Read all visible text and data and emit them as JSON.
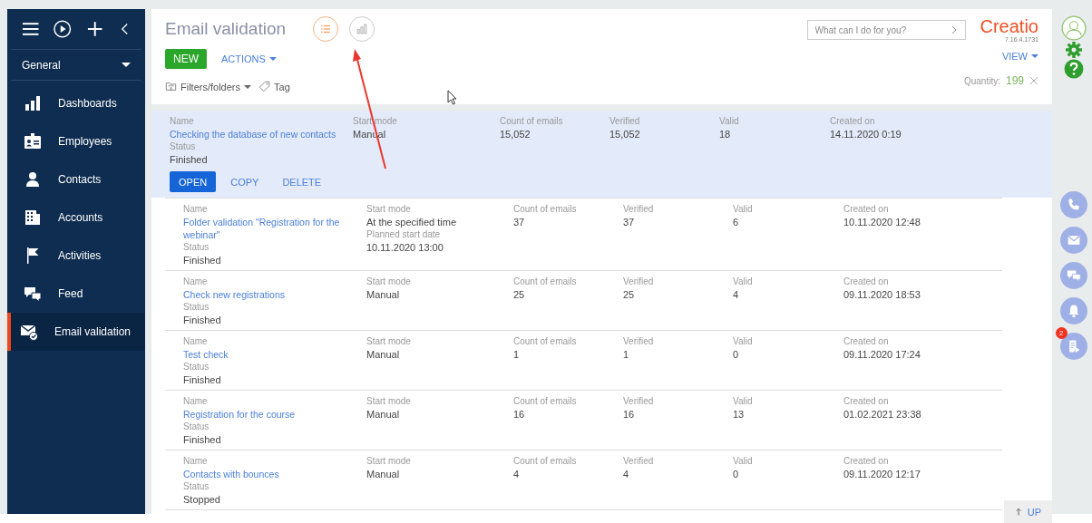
{
  "sidebar": {
    "section": "General",
    "items": [
      {
        "label": "Dashboards",
        "kind": "dashboards",
        "selected": false
      },
      {
        "label": "Employees",
        "kind": "employees",
        "selected": false
      },
      {
        "label": "Contacts",
        "kind": "contacts",
        "selected": false
      },
      {
        "label": "Accounts",
        "kind": "accounts",
        "selected": false
      },
      {
        "label": "Activities",
        "kind": "activities",
        "selected": false
      },
      {
        "label": "Feed",
        "kind": "feed",
        "selected": false
      },
      {
        "label": "Email validation",
        "kind": "email",
        "selected": true
      }
    ]
  },
  "header": {
    "title": "Email validation",
    "view_modes": [
      {
        "kind": "list",
        "selected": true
      },
      {
        "kind": "chart",
        "selected": false
      }
    ],
    "new_button": "NEW",
    "actions_menu": "ACTIONS",
    "search": {
      "placeholder": "What can I do for you?"
    },
    "logo": "Creatio",
    "version": "7.16.4.1731",
    "view_menu": "VIEW",
    "filters": "Filters/folders",
    "tag": "Tag",
    "quantity_label": "Quantity:",
    "quantity": "199"
  },
  "rows": [
    {
      "selected": true,
      "columns": [
        [
          {
            "label": "Name",
            "value": "Checking the database of new contacts",
            "kind": "link"
          },
          {
            "label": "Status",
            "value": "Finished",
            "kind": "text"
          }
        ],
        [
          {
            "label": "Start mode",
            "value": "Manual",
            "kind": "text"
          }
        ],
        [
          {
            "label": "Count of emails",
            "value": "15,052",
            "kind": "text"
          }
        ],
        [
          {
            "label": "Verified",
            "value": "15,052",
            "kind": "text"
          }
        ],
        [
          {
            "label": "Valid",
            "value": "18",
            "kind": "text"
          }
        ],
        [
          {
            "label": "Created on",
            "value": "14.11.2020 0:19",
            "kind": "text"
          }
        ]
      ],
      "actions": [
        "OPEN",
        "COPY",
        "DELETE"
      ]
    },
    {
      "selected": false,
      "columns": [
        [
          {
            "label": "Name",
            "value": "Folder validation \"Registration for the webinar\"",
            "kind": "link"
          },
          {
            "label": "Status",
            "value": "Finished",
            "kind": "text"
          }
        ],
        [
          {
            "label": "Start mode",
            "value": "At the specified time",
            "kind": "text"
          },
          {
            "label": "Planned start date",
            "value": "10.11.2020 13:00",
            "kind": "text"
          }
        ],
        [
          {
            "label": "Count of emails",
            "value": "37",
            "kind": "text"
          }
        ],
        [
          {
            "label": "Verified",
            "value": "37",
            "kind": "text"
          }
        ],
        [
          {
            "label": "Valid",
            "value": "6",
            "kind": "text"
          }
        ],
        [
          {
            "label": "Created on",
            "value": "10.11.2020 12:48",
            "kind": "text"
          }
        ]
      ]
    },
    {
      "selected": false,
      "columns": [
        [
          {
            "label": "Name",
            "value": "Check new registrations",
            "kind": "link"
          },
          {
            "label": "Status",
            "value": "Finished",
            "kind": "text"
          }
        ],
        [
          {
            "label": "Start mode",
            "value": "Manual",
            "kind": "text"
          }
        ],
        [
          {
            "label": "Count of emails",
            "value": "25",
            "kind": "text"
          }
        ],
        [
          {
            "label": "Verified",
            "value": "25",
            "kind": "text"
          }
        ],
        [
          {
            "label": "Valid",
            "value": "4",
            "kind": "text"
          }
        ],
        [
          {
            "label": "Created on",
            "value": "09.11.2020 18:53",
            "kind": "text"
          }
        ]
      ]
    },
    {
      "selected": false,
      "columns": [
        [
          {
            "label": "Name",
            "value": "Test check",
            "kind": "link"
          },
          {
            "label": "Status",
            "value": "Finished",
            "kind": "text"
          }
        ],
        [
          {
            "label": "Start mode",
            "value": "Manual",
            "kind": "text"
          }
        ],
        [
          {
            "label": "Count of emails",
            "value": "1",
            "kind": "text"
          }
        ],
        [
          {
            "label": "Verified",
            "value": "1",
            "kind": "text"
          }
        ],
        [
          {
            "label": "Valid",
            "value": "0",
            "kind": "text"
          }
        ],
        [
          {
            "label": "Created on",
            "value": "09.11.2020 17:24",
            "kind": "text"
          }
        ]
      ]
    },
    {
      "selected": false,
      "columns": [
        [
          {
            "label": "Name",
            "value": "Registration for the course",
            "kind": "link"
          },
          {
            "label": "Status",
            "value": "Finished",
            "kind": "text"
          }
        ],
        [
          {
            "label": "Start mode",
            "value": "Manual",
            "kind": "text"
          }
        ],
        [
          {
            "label": "Count of emails",
            "value": "16",
            "kind": "text"
          }
        ],
        [
          {
            "label": "Verified",
            "value": "16",
            "kind": "text"
          }
        ],
        [
          {
            "label": "Valid",
            "value": "13",
            "kind": "text"
          }
        ],
        [
          {
            "label": "Created on",
            "value": "01.02.2021 23:38",
            "kind": "text"
          }
        ]
      ]
    },
    {
      "selected": false,
      "columns": [
        [
          {
            "label": "Name",
            "value": "Contacts with bounces",
            "kind": "link"
          },
          {
            "label": "Status",
            "value": "Stopped",
            "kind": "text"
          }
        ],
        [
          {
            "label": "Start mode",
            "value": "Manual",
            "kind": "text"
          }
        ],
        [
          {
            "label": "Count of emails",
            "value": "4",
            "kind": "text"
          }
        ],
        [
          {
            "label": "Verified",
            "value": "4",
            "kind": "text"
          }
        ],
        [
          {
            "label": "Valid",
            "value": "0",
            "kind": "text"
          }
        ],
        [
          {
            "label": "Created on",
            "value": "09.11.2020 12:17",
            "kind": "text"
          }
        ]
      ]
    }
  ],
  "scroll_up_button": "UP",
  "right_panel": {
    "buttons": [
      {
        "kind": "phone"
      },
      {
        "kind": "mail"
      },
      {
        "kind": "chat"
      },
      {
        "kind": "bell"
      },
      {
        "kind": "document",
        "badge": "2"
      }
    ]
  }
}
